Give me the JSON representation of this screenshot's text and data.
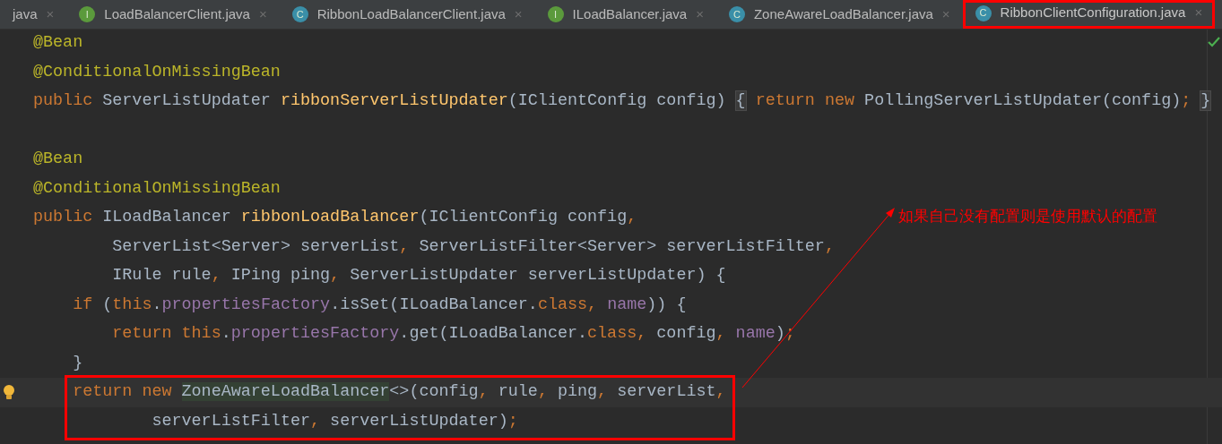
{
  "tabs": [
    {
      "label": "java",
      "close": "×",
      "selected": false,
      "boxed": false
    },
    {
      "label": "LoadBalancerClient.java",
      "badge": "I",
      "close": "×",
      "selected": false,
      "boxed": false
    },
    {
      "label": "RibbonLoadBalancerClient.java",
      "badge": "C",
      "close": "×",
      "selected": false,
      "boxed": false
    },
    {
      "label": "ILoadBalancer.java",
      "badge": "I",
      "close": "×",
      "selected": false,
      "boxed": false
    },
    {
      "label": "ZoneAwareLoadBalancer.java",
      "badge": "C",
      "close": "×",
      "selected": false,
      "boxed": false
    },
    {
      "label": "RibbonClientConfiguration.java",
      "badge": "C",
      "close": "×",
      "selected": true,
      "boxed": true
    }
  ],
  "lines": [
    {
      "kind": "code",
      "segments": [
        {
          "text": "@Bean",
          "kind": "ann"
        }
      ]
    },
    {
      "kind": "code",
      "segments": [
        {
          "text": "@ConditionalOnMissingBean",
          "kind": "ann"
        }
      ]
    },
    {
      "kind": "code",
      "segments": [
        {
          "text": "public ",
          "kind": "kw"
        },
        {
          "text": "ServerListUpdater ",
          "kind": "plain"
        },
        {
          "text": "ribbonServerListUpdater",
          "kind": "fn"
        },
        {
          "text": "(IClientConfig config) ",
          "kind": "plain"
        },
        {
          "text": "{",
          "kind": "fold"
        },
        {
          "text": " return new ",
          "kind": "kw"
        },
        {
          "text": "PollingServerListUpdater(config)",
          "kind": "plain"
        },
        {
          "text": "; ",
          "kind": "kw"
        },
        {
          "text": "}",
          "kind": "fold"
        }
      ]
    },
    {
      "kind": "blank"
    },
    {
      "kind": "code",
      "segments": [
        {
          "text": "@Bean",
          "kind": "ann"
        }
      ]
    },
    {
      "kind": "code",
      "segments": [
        {
          "text": "@ConditionalOnMissingBean",
          "kind": "ann"
        }
      ]
    },
    {
      "kind": "code",
      "segments": [
        {
          "text": "public ",
          "kind": "kw"
        },
        {
          "text": "ILoadBalancer ",
          "kind": "plain"
        },
        {
          "text": "ribbonLoadBalancer",
          "kind": "fn"
        },
        {
          "text": "(IClientConfig config",
          "kind": "plain"
        },
        {
          "text": ",",
          "kind": "kw"
        }
      ]
    },
    {
      "kind": "code",
      "segments": [
        {
          "text": "        ServerList<Server> serverList",
          "kind": "plain"
        },
        {
          "text": ", ",
          "kind": "kw"
        },
        {
          "text": "ServerListFilter<Server> serverListFilter",
          "kind": "plain"
        },
        {
          "text": ",",
          "kind": "kw"
        }
      ]
    },
    {
      "kind": "code",
      "segments": [
        {
          "text": "        IRule rule",
          "kind": "plain"
        },
        {
          "text": ", ",
          "kind": "kw"
        },
        {
          "text": "IPing ping",
          "kind": "plain"
        },
        {
          "text": ", ",
          "kind": "kw"
        },
        {
          "text": "ServerListUpdater serverListUpdater) {",
          "kind": "plain"
        }
      ]
    },
    {
      "kind": "code",
      "segments": [
        {
          "text": "    if ",
          "kind": "kw"
        },
        {
          "text": "(",
          "kind": "plain"
        },
        {
          "text": "this",
          "kind": "kw"
        },
        {
          "text": ".",
          "kind": "plain"
        },
        {
          "text": "propertiesFactory",
          "kind": "field"
        },
        {
          "text": ".isSet(ILoadBalancer.",
          "kind": "plain"
        },
        {
          "text": "class",
          "kind": "kw"
        },
        {
          "text": ", ",
          "kind": "kw"
        },
        {
          "text": "name",
          "kind": "field"
        },
        {
          "text": ")) {",
          "kind": "plain"
        }
      ]
    },
    {
      "kind": "code",
      "segments": [
        {
          "text": "        return this",
          "kind": "kw"
        },
        {
          "text": ".",
          "kind": "plain"
        },
        {
          "text": "propertiesFactory",
          "kind": "field"
        },
        {
          "text": ".get(ILoadBalancer.",
          "kind": "plain"
        },
        {
          "text": "class",
          "kind": "kw"
        },
        {
          "text": ", ",
          "kind": "kw"
        },
        {
          "text": "config",
          "kind": "plain"
        },
        {
          "text": ", ",
          "kind": "kw"
        },
        {
          "text": "name",
          "kind": "field"
        },
        {
          "text": ")",
          "kind": "plain"
        },
        {
          "text": ";",
          "kind": "kw"
        }
      ]
    },
    {
      "kind": "code",
      "segments": [
        {
          "text": "    }",
          "kind": "plain"
        }
      ]
    },
    {
      "kind": "boxed",
      "lines": [
        {
          "kind": "current",
          "segments": [
            {
              "text": "    return new ",
              "kind": "kw"
            },
            {
              "text": "ZoneAwareLoadBalancer",
              "kind": "match"
            },
            {
              "text": "<>(config",
              "kind": "plain"
            },
            {
              "text": ", ",
              "kind": "kw"
            },
            {
              "text": "rule",
              "kind": "plain"
            },
            {
              "text": ", ",
              "kind": "kw"
            },
            {
              "text": "ping",
              "kind": "plain"
            },
            {
              "text": ", ",
              "kind": "kw"
            },
            {
              "text": "serverList",
              "kind": "plain"
            },
            {
              "text": ",",
              "kind": "kw"
            }
          ]
        },
        {
          "kind": "code",
          "segments": [
            {
              "text": "            serverListFilter",
              "kind": "plain"
            },
            {
              "text": ", ",
              "kind": "kw"
            },
            {
              "text": "serverListUpdater)",
              "kind": "plain"
            },
            {
              "text": ";",
              "kind": "kw"
            }
          ]
        }
      ]
    }
  ],
  "annotation": {
    "text": "如果自己没有配置则是使用默认的配置",
    "color": "#ff0000"
  }
}
